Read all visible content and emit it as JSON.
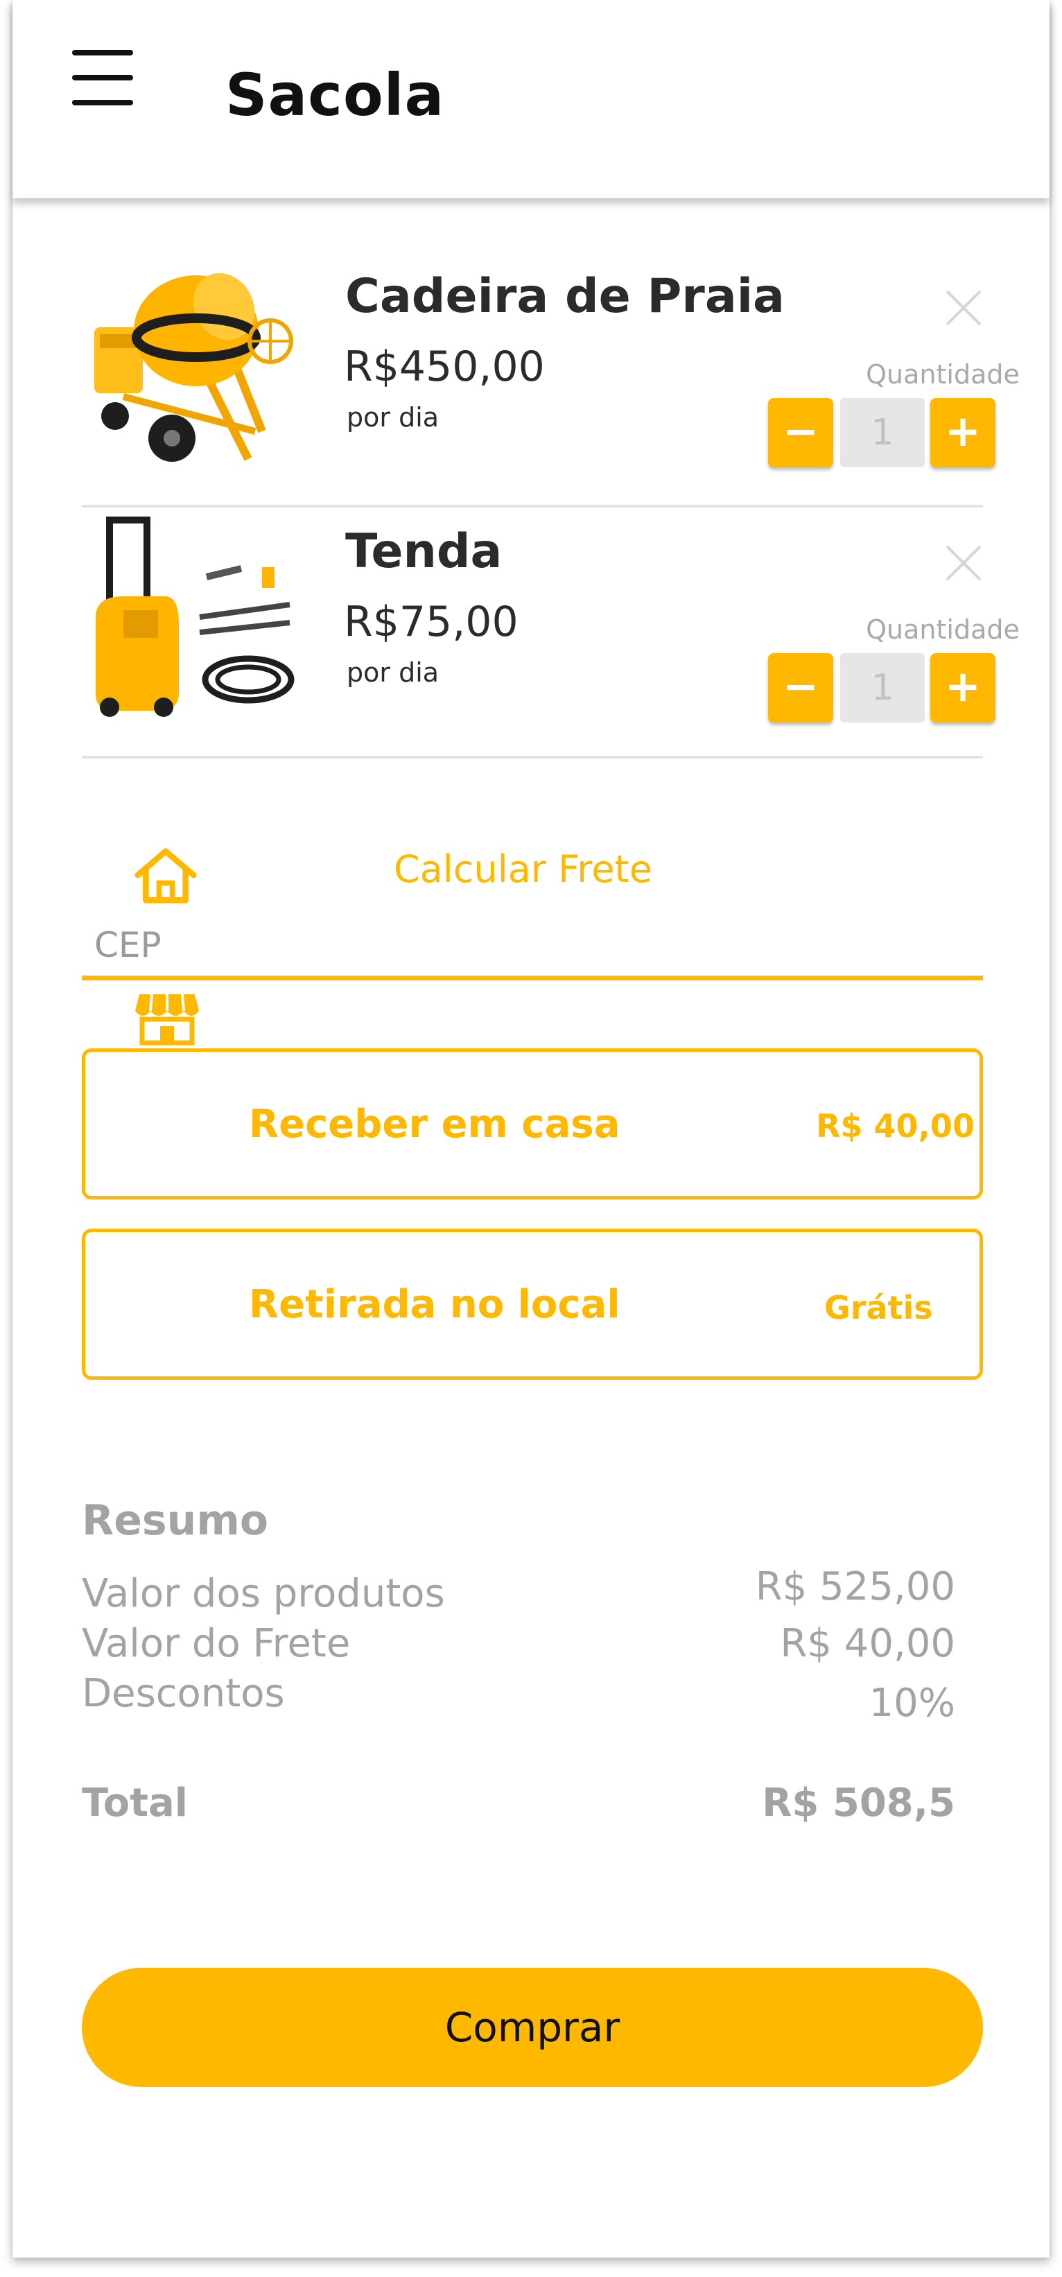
{
  "header": {
    "title": "Sacola",
    "menu_icon": "hamburger-menu-icon"
  },
  "cart": {
    "items": [
      {
        "name": "Cadeira de Praia",
        "price": "R$450,00",
        "period": "por dia",
        "quantity_label": "Quantidade",
        "quantity": "1",
        "decrement": "−",
        "increment": "+",
        "image": "concrete-mixer-image"
      },
      {
        "name": "Tenda",
        "price": "R$75,00",
        "period": "por dia",
        "quantity_label": "Quantidade",
        "quantity": "1",
        "decrement": "−",
        "increment": "+",
        "image": "pressure-washer-image"
      }
    ]
  },
  "shipping": {
    "calc_label": "Calcular Frete",
    "cep_placeholder": "CEP",
    "options": [
      {
        "label": "Receber em casa",
        "price": "R$ 40,00"
      },
      {
        "label": "Retirada no local",
        "price": "Grátis"
      }
    ]
  },
  "summary": {
    "title": "Resumo",
    "rows": [
      {
        "label": "Valor dos produtos",
        "value": "R$ 525,00"
      },
      {
        "label": "Valor do Frete",
        "value": "R$ 40,00"
      },
      {
        "label": "Descontos",
        "value": "10%"
      }
    ],
    "total_label": "Total",
    "total_value": "R$ 508,5"
  },
  "actions": {
    "buy_label": "Comprar"
  },
  "colors": {
    "accent": "#ffb800",
    "text_dark": "#2b2b2b",
    "text_muted": "#a3a3a3",
    "qty_field": "#e6e6e6"
  }
}
